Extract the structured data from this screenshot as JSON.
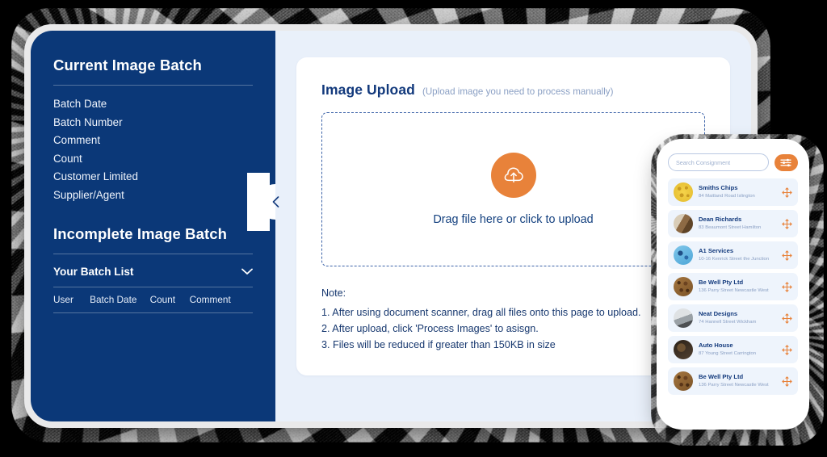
{
  "colors": {
    "navy": "#0b3878",
    "orange": "#e8823a",
    "page_bg": "#e9f0fa",
    "title_blue": "#12397c",
    "muted_blue": "#8ba0c4"
  },
  "sidebar": {
    "current_batch_title": "Current Image Batch",
    "fields": [
      "Batch Date",
      "Batch Number",
      "Comment",
      "Count",
      "Customer Limited",
      "Supplier/Agent"
    ],
    "incomplete_batch_title": "Incomplete Image Batch",
    "batch_list_label": "Your Batch List",
    "batch_list_icon": "chevron-down-icon",
    "table_headers": [
      "User",
      "Batch Date",
      "Count",
      "Comment"
    ],
    "collapse_icon": "chevron-left-icon"
  },
  "main": {
    "card_title": "Image Upload",
    "card_subtitle": "(Upload image you need to process manually)",
    "dropzone": {
      "icon": "cloud-upload-icon",
      "text": "Drag file here or click to upload"
    },
    "note": {
      "label": "Note:",
      "lines": [
        "1. After using document scanner, drag all files onto this page to upload.",
        "2. After upload, click 'Process Images' to asisgn.",
        "3. Files will be reduced if greater than 150KB in size"
      ]
    }
  },
  "phone": {
    "search": {
      "placeholder": "Search Consignment",
      "value": ""
    },
    "filter_icon": "filter-sliders-icon",
    "consignments": [
      {
        "name": "Smiths Chips",
        "address": "84 Maitland Road Islington"
      },
      {
        "name": "Dean Richards",
        "address": "83 Beaumont Street Hamilton"
      },
      {
        "name": "A1 Services",
        "address": "10-16 Kenrick Street the Junction"
      },
      {
        "name": "Be Well Pty Ltd",
        "address": "136 Parry Street Newcastle West"
      },
      {
        "name": "Neat Designs",
        "address": "74 Hannell Street Wickham"
      },
      {
        "name": "Auto House",
        "address": "87 Young Street Carrington"
      },
      {
        "name": "Be Well Pty Ltd",
        "address": "136 Parry Street Newcastle West"
      }
    ],
    "row_handle_icon": "move-arrows-icon"
  }
}
